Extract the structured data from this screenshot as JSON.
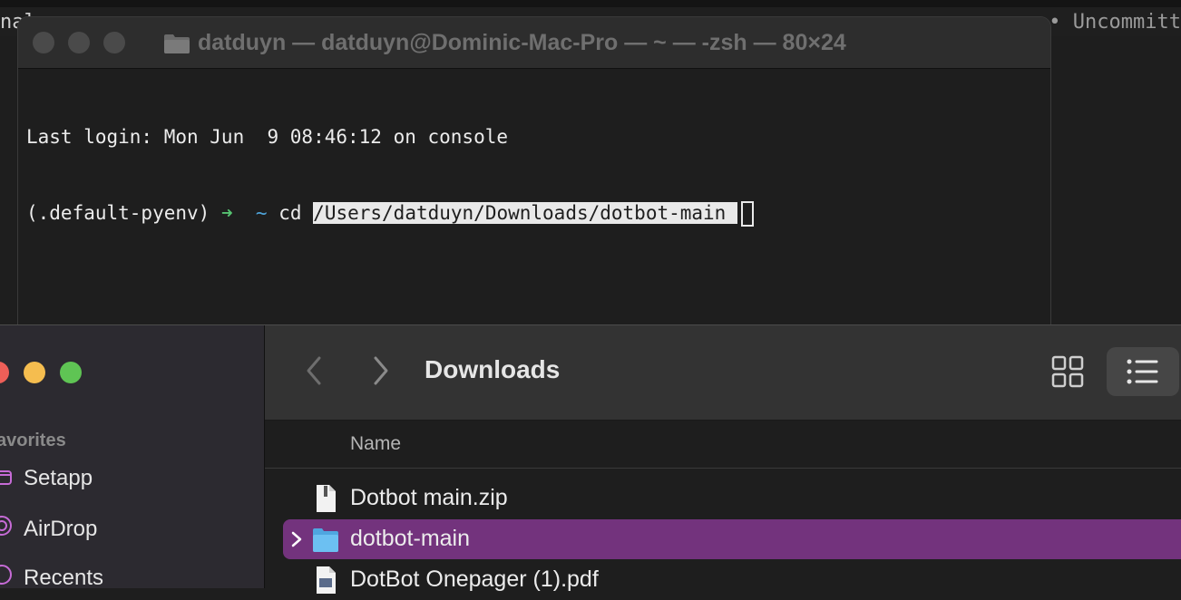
{
  "background_editor": {
    "left_text": "nal",
    "right_text": "• Uncommitt"
  },
  "terminal": {
    "title": "datduyn — datduyn@Dominic-Mac-Pro — ~ — -zsh — 80×24",
    "last_login": "Last login: Mon Jun  9 08:46:12 on console",
    "prompt_env": "(.default-pyenv)",
    "prompt_arrow": "➜",
    "prompt_dir": "~",
    "command": "cd",
    "path_argument": "/Users/datduyn/Downloads/dotbot-main "
  },
  "finder": {
    "sidebar": {
      "section_title": "avorites",
      "items": [
        {
          "label": "Setapp",
          "icon": "setapp-icon"
        },
        {
          "label": "AirDrop",
          "icon": "airdrop-icon"
        },
        {
          "label": "Recents",
          "icon": "recents-icon"
        }
      ]
    },
    "toolbar": {
      "title": "Downloads"
    },
    "list": {
      "column_name": "Name",
      "rows": [
        {
          "name": "Dotbot main.zip",
          "icon": "zip-file-icon",
          "selected": false
        },
        {
          "name": "dotbot-main",
          "icon": "folder-icon",
          "selected": true
        },
        {
          "name": "DotBot Onepager (1).pdf",
          "icon": "pdf-file-icon",
          "selected": false
        }
      ]
    }
  },
  "colors": {
    "selection": "#73337d",
    "prompt_arrow": "#56c271",
    "prompt_tilde": "#4ea3d8",
    "close": "#ee5f58",
    "minimize": "#f5bd4f",
    "zoom": "#5fc454"
  }
}
